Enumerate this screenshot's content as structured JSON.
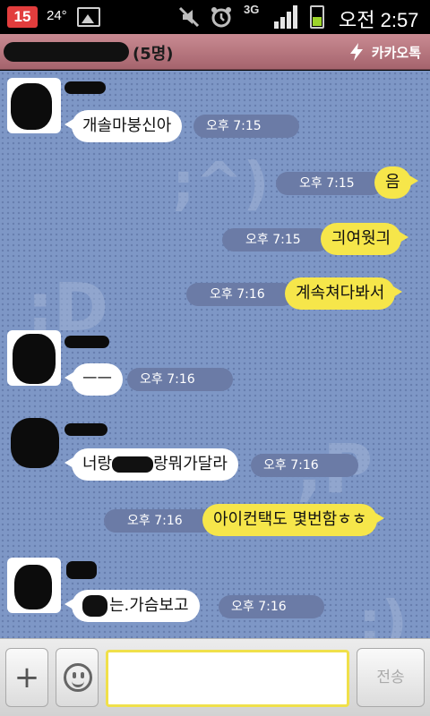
{
  "status_bar": {
    "calendar_day": "15",
    "temperature": "24°",
    "network": "3G",
    "time": "오전 2:57",
    "icons": [
      "calendar-icon",
      "gallery-icon",
      "mute-icon",
      "alarm-icon",
      "signal-icon",
      "battery-icon"
    ]
  },
  "title_bar": {
    "member_count": "(5명)",
    "brand_label": "카카오톡",
    "brand_icon": "kakao-bolt-icon"
  },
  "messages": [
    {
      "side": "in",
      "text": "개솔마붕신아",
      "time": "오후 7:15"
    },
    {
      "side": "out",
      "text": "음",
      "time": "오후 7:15"
    },
    {
      "side": "out",
      "text": "긔여웟긔",
      "time": "오후 7:15"
    },
    {
      "side": "out",
      "text": "계속쳐다봐서",
      "time": "오후 7:16"
    },
    {
      "side": "in",
      "text": "ㅡㅡ",
      "time": "오후 7:16"
    },
    {
      "side": "in",
      "text_before": "너랑",
      "text_after": "랑뭐가달라",
      "time": "오후 7:16"
    },
    {
      "side": "out",
      "text": "아이컨택도 몇번함ㅎㅎ",
      "time": "오후 7:16"
    },
    {
      "side": "in",
      "text": "는.가슴보고",
      "time": "오후 7:16"
    }
  ],
  "watermarks": [
    ";^)",
    ":D",
    ";P",
    ":)"
  ],
  "input_bar": {
    "plus_label": "+",
    "message_value": "",
    "send_label": "전송"
  },
  "colors": {
    "chat_bg": "#7e97c6",
    "title_bg": "#b5747c",
    "outgoing_bubble": "#f6e64a",
    "incoming_bubble": "#ffffff",
    "timestamp_pill": "#6b7ba6"
  }
}
